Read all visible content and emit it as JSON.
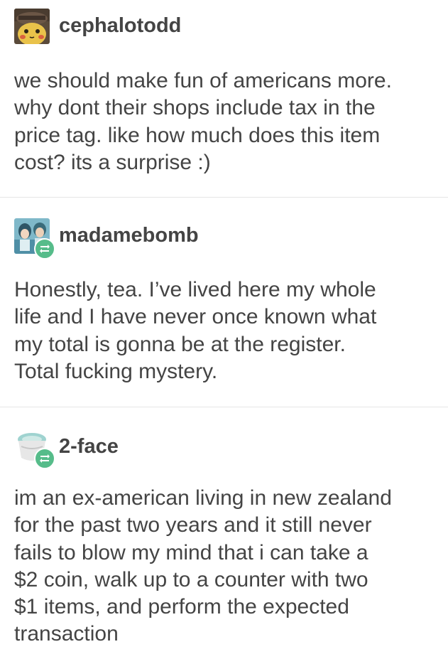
{
  "posts": [
    {
      "username": "cephalotodd",
      "avatar_icon": "pikachu-detective-avatar",
      "reblog": false,
      "text": "we should make fun of americans more.\nwhy dont their shops include tax in the\nprice tag. like how much does this item\ncost? its a surprise :)"
    },
    {
      "username": "madamebomb",
      "avatar_icon": "anime-characters-avatar",
      "reblog": true,
      "reblog_icon": "reblog-icon",
      "text": "Honestly, tea. I’ve lived here my whole\nlife and I have never once known what\nmy total is gonna be at the register.\nTotal fucking mystery."
    },
    {
      "username": "2-face",
      "avatar_icon": "cup-container-avatar",
      "reblog": true,
      "reblog_icon": "reblog-icon",
      "text": "im an ex-american living in new zealand\nfor the past two years and it still never\nfails to blow my mind that i can take a\n$2 coin, walk up to a counter with two\n$1 items, and perform the expected\ntransaction"
    }
  ],
  "colors": {
    "text": "#444444",
    "divider": "#e6e6e6",
    "reblog_badge": "#56bc8a"
  }
}
